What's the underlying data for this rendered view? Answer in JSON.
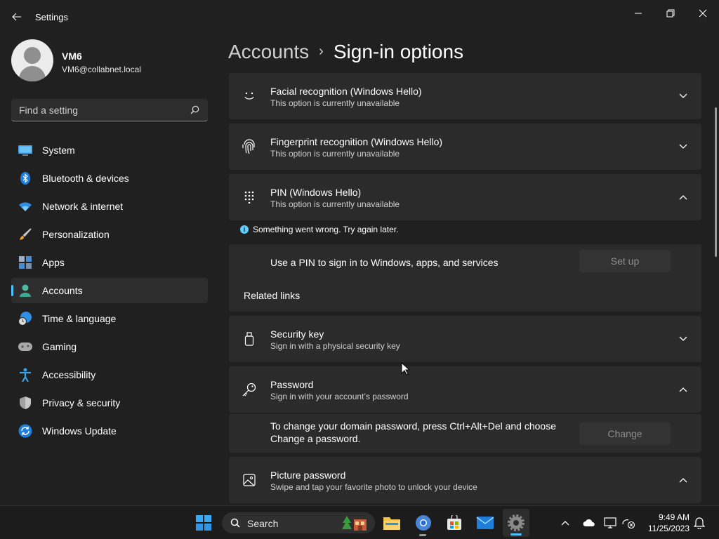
{
  "window": {
    "title": "Settings",
    "back_icon": "arrow-left-icon",
    "controls": [
      "minimize-icon",
      "restore-icon",
      "close-icon"
    ]
  },
  "profile": {
    "name": "VM6",
    "email": "VM6@collabnet.local"
  },
  "search": {
    "placeholder": "Find a setting"
  },
  "nav": {
    "items": [
      {
        "label": "System",
        "icon": "monitor-icon"
      },
      {
        "label": "Bluetooth & devices",
        "icon": "bluetooth-icon"
      },
      {
        "label": "Network & internet",
        "icon": "wifi-icon"
      },
      {
        "label": "Personalization",
        "icon": "brush-icon"
      },
      {
        "label": "Apps",
        "icon": "apps-icon"
      },
      {
        "label": "Accounts",
        "icon": "person-icon"
      },
      {
        "label": "Time & language",
        "icon": "globe-clock-icon"
      },
      {
        "label": "Gaming",
        "icon": "gamepad-icon"
      },
      {
        "label": "Accessibility",
        "icon": "accessibility-icon"
      },
      {
        "label": "Privacy & security",
        "icon": "shield-icon"
      },
      {
        "label": "Windows Update",
        "icon": "refresh-icon"
      }
    ],
    "active": "Accounts"
  },
  "breadcrumb": {
    "parent": "Accounts",
    "separator": "›",
    "current": "Sign-in options"
  },
  "options": {
    "facial": {
      "title": "Facial recognition (Windows Hello)",
      "subtitle": "This option is currently unavailable",
      "icon": "smile-icon"
    },
    "fingerprint": {
      "title": "Fingerprint recognition (Windows Hello)",
      "subtitle": "This option is currently unavailable",
      "icon": "fingerprint-icon"
    },
    "pin": {
      "title": "PIN (Windows Hello)",
      "subtitle": "This option is currently unavailable",
      "icon": "keypad-icon",
      "error": "Something went wrong. Try again later.",
      "row_text": "Use a PIN to sign in to Windows, apps, and services",
      "button": "Set up",
      "related": "Related links"
    },
    "security_key": {
      "title": "Security key",
      "subtitle": "Sign in with a physical security key",
      "icon": "usb-key-icon"
    },
    "password": {
      "title": "Password",
      "subtitle": "Sign in with your account’s password",
      "icon": "key-icon",
      "row_line1": "To change your domain password, press Ctrl+Alt+Del and choose",
      "row_line2": "Change a password.",
      "button": "Change"
    },
    "picture": {
      "title": "Picture password",
      "subtitle": "Swipe and tap your favorite photo to unlock your device",
      "icon": "picture-icon"
    }
  },
  "taskbar": {
    "search_label": "Search",
    "time": "9:49 AM",
    "date": "11/25/2023",
    "apps": [
      "start-icon",
      "search-icon",
      "file-explorer-icon",
      "chrome-icon",
      "store-icon",
      "mail-icon",
      "settings-icon"
    ],
    "tray": [
      "chevron-up-icon",
      "cloud-icon",
      "display-icon",
      "network-icon",
      "bell-icon"
    ]
  },
  "colors": {
    "background": "#202020",
    "card": "#2b2b2b",
    "accent": "#4cc2ff"
  }
}
